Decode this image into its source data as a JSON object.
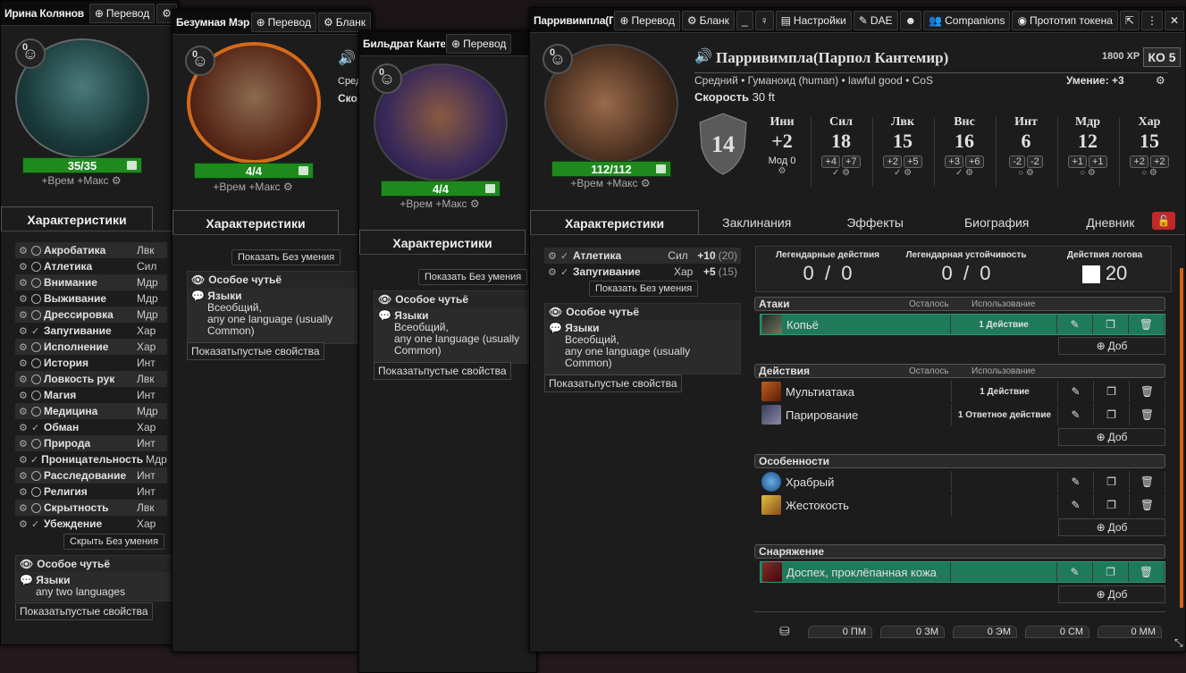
{
  "window1": {
    "title": "Ирина Колянов",
    "translate": "Перевод",
    "inspiration": "0",
    "hp": "35/35",
    "tempmax": "+Врем +Макс",
    "tab": "Характеристики",
    "skills": [
      {
        "name": "Акробатика",
        "ab": "Лвк",
        "p": false
      },
      {
        "name": "Атлетика",
        "ab": "Сил",
        "p": false
      },
      {
        "name": "Внимание",
        "ab": "Мдр",
        "p": false
      },
      {
        "name": "Выживание",
        "ab": "Мдр",
        "p": false
      },
      {
        "name": "Дрессировка",
        "ab": "Мдр",
        "p": false
      },
      {
        "name": "Запугивание",
        "ab": "Хар",
        "p": true
      },
      {
        "name": "Исполнение",
        "ab": "Хар",
        "p": false
      },
      {
        "name": "История",
        "ab": "Инт",
        "p": false
      },
      {
        "name": "Ловкость рук",
        "ab": "Лвк",
        "p": false
      },
      {
        "name": "Магия",
        "ab": "Инт",
        "p": false
      },
      {
        "name": "Медицина",
        "ab": "Мдр",
        "p": false
      },
      {
        "name": "Обман",
        "ab": "Хар",
        "p": true
      },
      {
        "name": "Природа",
        "ab": "Инт",
        "p": false
      },
      {
        "name": "Проницательность",
        "ab": "Мдр",
        "p": true
      },
      {
        "name": "Расследование",
        "ab": "Инт",
        "p": false
      },
      {
        "name": "Религия",
        "ab": "Инт",
        "p": false
      },
      {
        "name": "Скрытность",
        "ab": "Лвк",
        "p": false
      },
      {
        "name": "Убеждение",
        "ab": "Хар",
        "p": true
      }
    ],
    "hide_btn": "Скрыть Без умения",
    "sense": "Особое чутьё",
    "lang_label": "Языки",
    "lang_value": "any two languages",
    "show_empty": "Показатьпустые свойства"
  },
  "window2": {
    "title": "Безумная Мэри",
    "translate": "Перевод",
    "blank": "Бланк",
    "inspiration": "0",
    "hp": "4/4",
    "tempmax": "+Врем +Макс",
    "tab": "Характеристики",
    "show_btn": "Показать Без умения",
    "sense": "Особое чутьё",
    "lang_label": "Языки",
    "lang_value": "Всеобщий,\nany one language (usually Common)",
    "show_empty": "Показатьпустые свойства",
    "peek1": "Сред",
    "peek2": "Ско"
  },
  "window3": {
    "title": "Бильдрат Канте",
    "translate": "Перевод",
    "inspiration": "0",
    "hp": "4/4",
    "tempmax": "+Врем +Макс",
    "tab": "Характеристики",
    "show_btn": "Показать Без умения",
    "sense": "Особое чутьё",
    "lang_label": "Языки",
    "lang_value": "Всеобщий,\nany one language (usually Common)",
    "show_empty": "Показатьпустые свойства"
  },
  "window4": {
    "title": "Парривимпла(П",
    "translate": "Перевод",
    "blank": "Бланк",
    "settings": "Настройки",
    "dae": "DAE",
    "companions": "Companions",
    "proto": "Прототип токена",
    "name": "Парривимпла(Парпол Кантемир)",
    "xp": "1800 XP",
    "cr": "КО 5",
    "subtitle": "Средний  •  Гуманоид (human)  •  lawful good  •  CoS",
    "skill_bonus": "Умение: +3",
    "speed_label": "Скорость",
    "speed": "30 ft",
    "ac": "14",
    "inspiration": "0",
    "hp": "112/112",
    "tempmax": "+Врем +Макс",
    "init": {
      "label": "Ини",
      "value": "+2",
      "mod_label": "Мод",
      "mod": "0"
    },
    "abilities": [
      {
        "n": "Сил",
        "v": "18",
        "m1": "+4",
        "m2": "+7"
      },
      {
        "n": "Лвк",
        "v": "15",
        "m1": "+2",
        "m2": "+5"
      },
      {
        "n": "Внс",
        "v": "16",
        "m1": "+3",
        "m2": "+6"
      },
      {
        "n": "Инт",
        "v": "6",
        "m1": "-2",
        "m2": "-2"
      },
      {
        "n": "Мдр",
        "v": "12",
        "m1": "+1",
        "m2": "+1"
      },
      {
        "n": "Хар",
        "v": "15",
        "m1": "+2",
        "m2": "+2"
      }
    ],
    "tabs": [
      "Характеристики",
      "Заклинания",
      "Эффекты",
      "Биография",
      "Дневник"
    ],
    "skills": [
      {
        "name": "Атлетика",
        "ab": "Сил",
        "mod": "+10",
        "pass": "(20)"
      },
      {
        "name": "Запугивание",
        "ab": "Хар",
        "mod": "+5",
        "pass": "(15)"
      }
    ],
    "show_btn": "Показать Без умения",
    "sense": "Особое чутьё",
    "lang_label": "Языки",
    "lang_value": "Всеобщий,\nany one language (usually Common)",
    "show_empty": "Показатьпустые свойства",
    "legendary": {
      "actions_label": "Легендарные действия",
      "actions_cur": "0",
      "actions_max": "0",
      "resist_label": "Легендарная устойчивость",
      "resist_cur": "0",
      "resist_max": "0",
      "lair_label": "Действия логова",
      "lair_value": "20"
    },
    "col_left": "Осталось",
    "col_use": "Использование",
    "sections": {
      "attacks": "Атаки",
      "actions": "Действия",
      "features": "Особенности",
      "equipment": "Снаряжение"
    },
    "items": {
      "spear": {
        "name": "Копьё",
        "use": "1 Действие"
      },
      "multi": {
        "name": "Мультиатака",
        "use": "1 Действие"
      },
      "parry": {
        "name": "Парирование",
        "use": "1 Ответное действие"
      },
      "brave": {
        "name": "Храбрый",
        "use": ""
      },
      "brutal": {
        "name": "Жестокость",
        "use": ""
      },
      "armor": {
        "name": "Доспех, проклёпанная кожа",
        "use": ""
      }
    },
    "add_label": "Доб",
    "currency": [
      "0 ПМ",
      "0 ЗМ",
      "0 ЭМ",
      "0 СМ",
      "0 ММ"
    ]
  },
  "colors": {
    "hp": "#1e8a1e",
    "highlight": "#1f7a5a",
    "lock": "#c0282c"
  }
}
